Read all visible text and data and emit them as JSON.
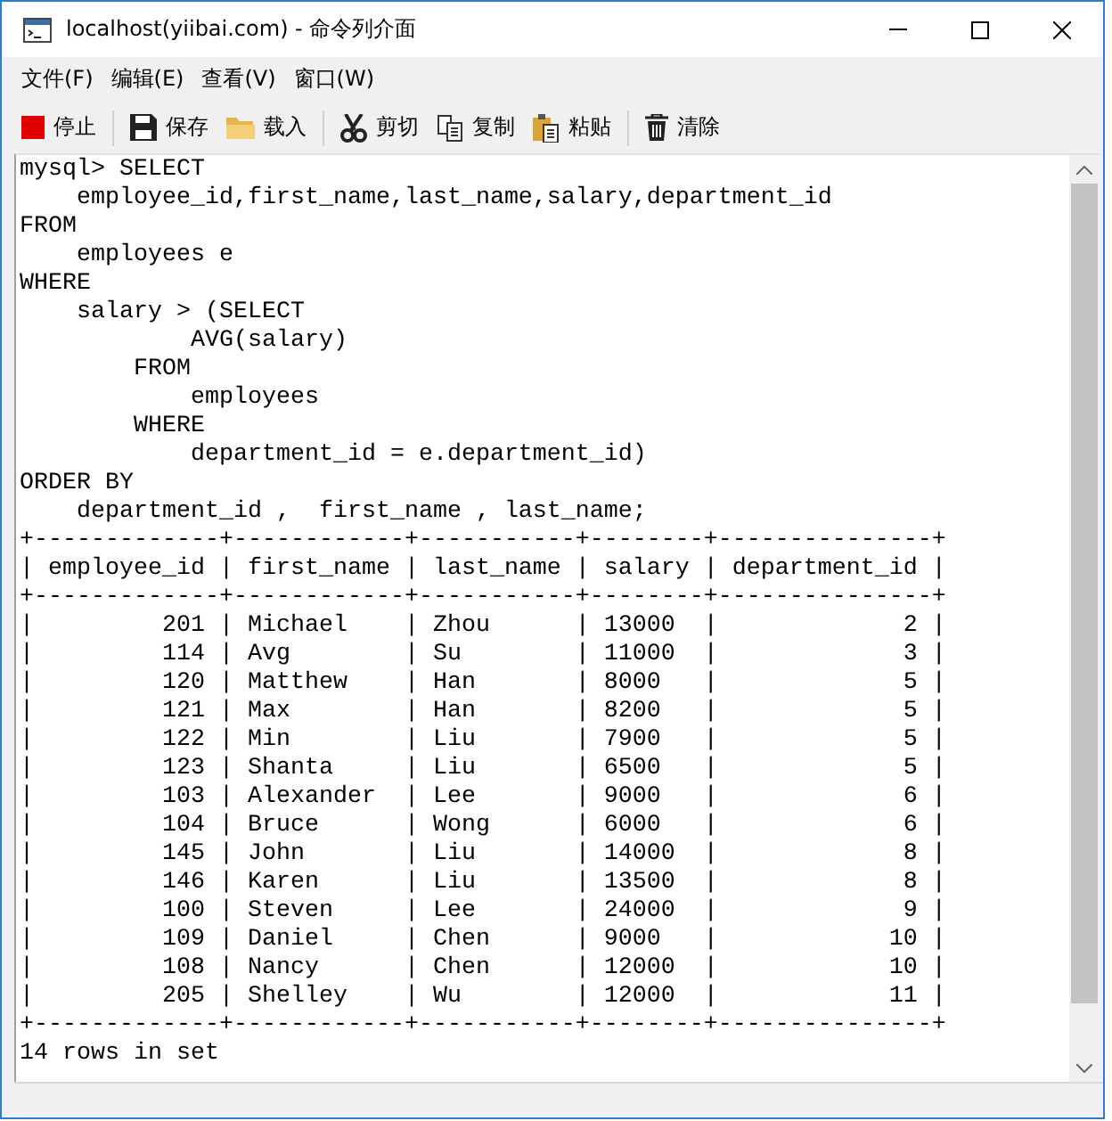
{
  "window": {
    "title": "localhost(yiibai.com) - 命令列介面"
  },
  "menu": [
    "文件(F)",
    "编辑(E)",
    "查看(V)",
    "窗口(W)"
  ],
  "toolbar": {
    "groups": [
      [
        "停止"
      ],
      [
        "保存",
        "载入"
      ],
      [
        "剪切",
        "复制",
        "粘贴"
      ],
      [
        "清除"
      ]
    ]
  },
  "console": {
    "lines": [
      "mysql> SELECT",
      "    employee_id,first_name,last_name,salary,department_id",
      "FROM",
      "    employees e",
      "WHERE",
      "    salary > (SELECT",
      "            AVG(salary)",
      "        FROM",
      "            employees",
      "        WHERE",
      "            department_id = e.department_id)",
      "ORDER BY",
      "    department_id ,  first_name , last_name;",
      "+-------------+------------+-----------+--------+---------------+",
      "| employee_id | first_name | last_name | salary | department_id |",
      "+-------------+------------+-----------+--------+---------------+",
      "|         201 | Michael    | Zhou      | 13000  |             2 |",
      "|         114 | Avg        | Su        | 11000  |             3 |",
      "|         120 | Matthew    | Han       | 8000   |             5 |",
      "|         121 | Max        | Han       | 8200   |             5 |",
      "|         122 | Min        | Liu       | 7900   |             5 |",
      "|         123 | Shanta     | Liu       | 6500   |             5 |",
      "|         103 | Alexander  | Lee       | 9000   |             6 |",
      "|         104 | Bruce      | Wong      | 6000   |             6 |",
      "|         145 | John       | Liu       | 14000  |             8 |",
      "|         146 | Karen      | Liu       | 13500  |             8 |",
      "|         100 | Steven     | Lee       | 24000  |             9 |",
      "|         109 | Daniel     | Chen      | 9000   |            10 |",
      "|         108 | Nancy      | Chen      | 12000  |            10 |",
      "|         205 | Shelley    | Wu        | 12000  |            11 |",
      "+-------------+------------+-----------+--------+---------------+",
      "14 rows in set"
    ]
  }
}
